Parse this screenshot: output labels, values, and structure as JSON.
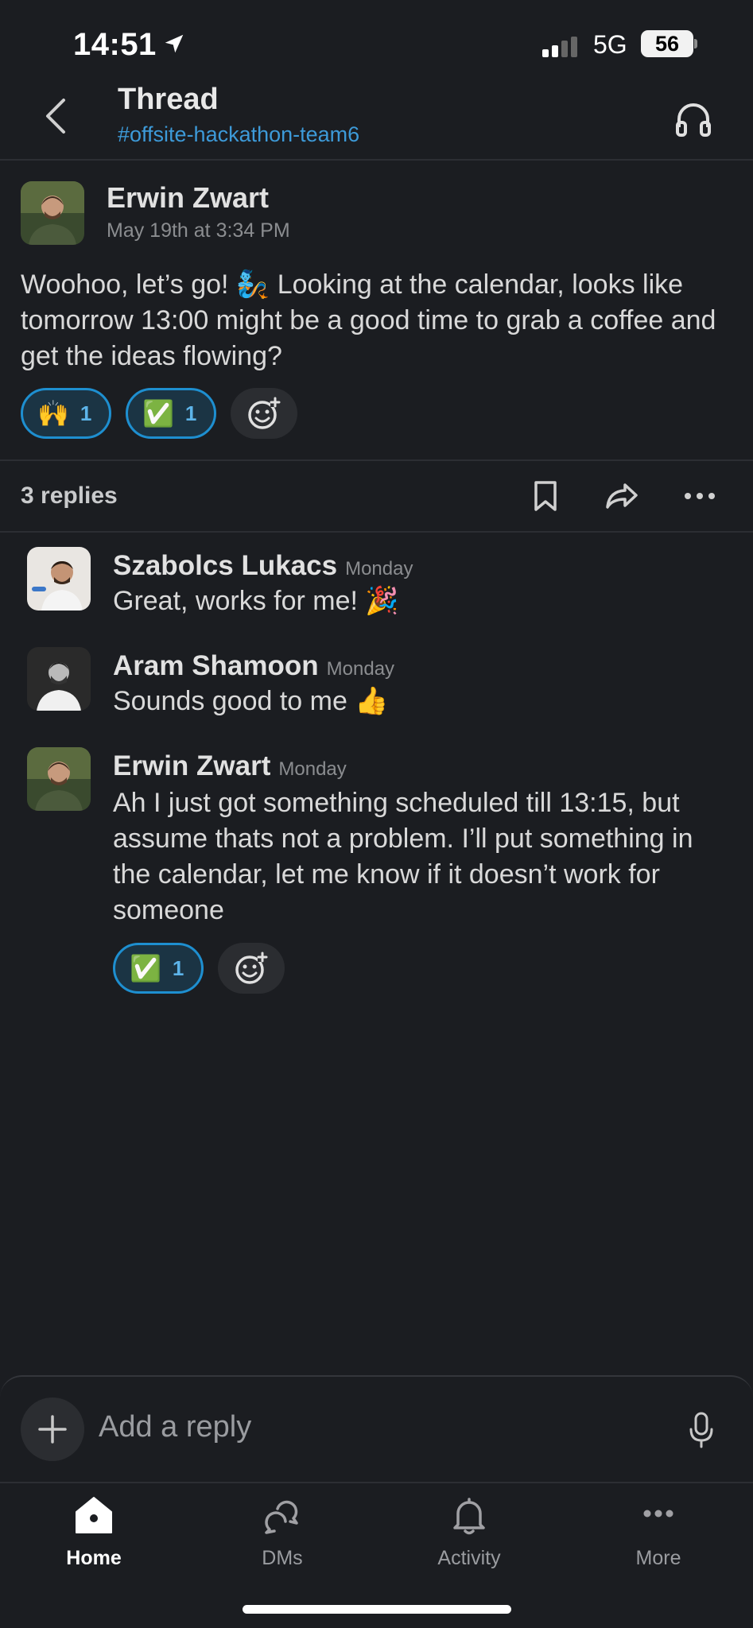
{
  "status_bar": {
    "time": "14:51",
    "network": "5G",
    "battery": "56"
  },
  "header": {
    "title": "Thread",
    "channel": "#offsite-hackathon-team6"
  },
  "parent_message": {
    "author": "Erwin Zwart",
    "timestamp": "May 19th at 3:34 PM",
    "text": "Woohoo, let’s go! 🧞 Looking at the calendar, looks like tomorrow 13:00 might be a good time to grab a coffee and get the ideas flowing?",
    "reactions": [
      {
        "emoji": "🙌",
        "count": "1"
      },
      {
        "emoji": "✅",
        "count": "1"
      }
    ]
  },
  "thread_bar": {
    "replies_label": "3 replies"
  },
  "replies": [
    {
      "author": "Szabolcs Lukacs",
      "time": "Monday",
      "text": "Great, works for me! 🎉"
    },
    {
      "author": "Aram Shamoon",
      "time": "Monday",
      "text": "Sounds good to me 👍"
    },
    {
      "author": "Erwin Zwart",
      "time": "Monday",
      "text": "Ah I just got something scheduled till 13:15, but assume thats not a problem. I’ll put something in the calendar, let me know if it doesn’t work for someone",
      "reactions": [
        {
          "emoji": "✅",
          "count": "1"
        }
      ]
    }
  ],
  "composer": {
    "placeholder": "Add a reply"
  },
  "tabs": [
    {
      "label": "Home",
      "icon": "home-icon",
      "active": true
    },
    {
      "label": "DMs",
      "icon": "dms-icon"
    },
    {
      "label": "Activity",
      "icon": "bell-icon"
    },
    {
      "label": "More",
      "icon": "more-icon"
    }
  ],
  "colors": {
    "background": "#1b1d21",
    "link": "#3d9ad8",
    "reaction_border": "#1e8fd0",
    "text": "#d9d9d9"
  }
}
